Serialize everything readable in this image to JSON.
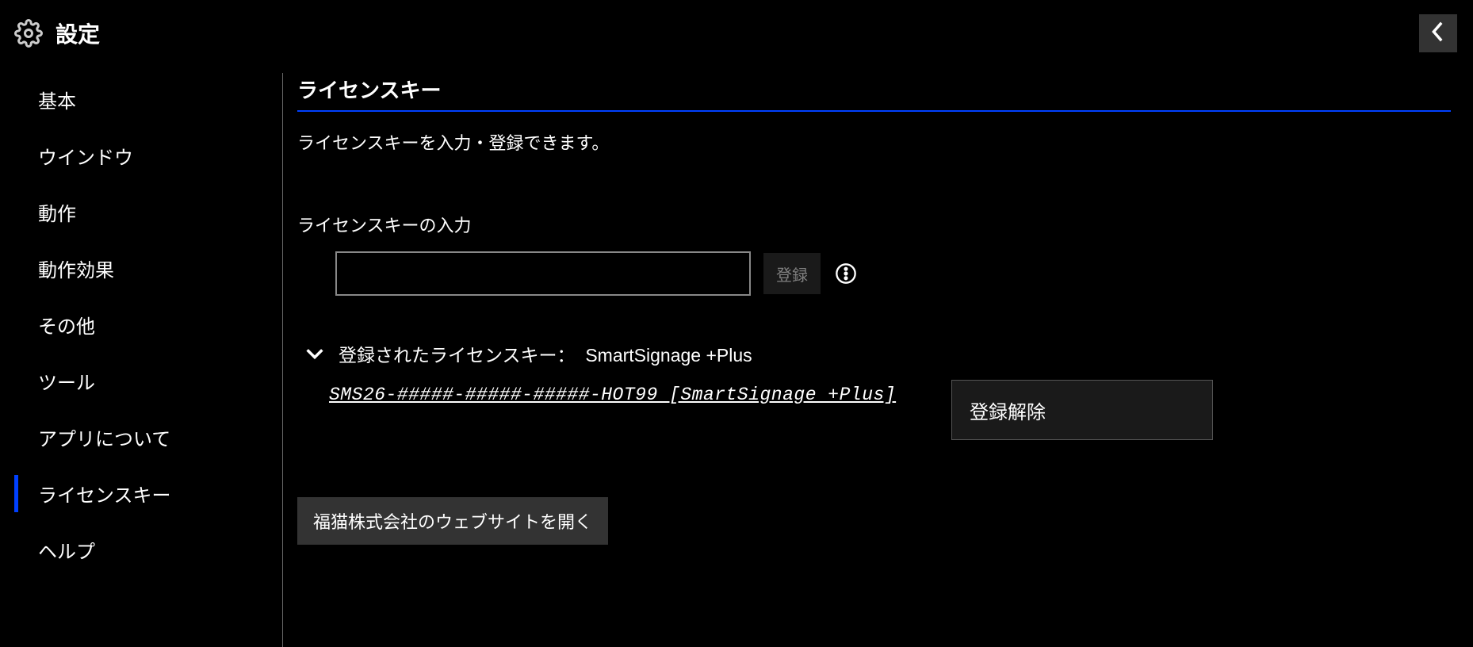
{
  "header": {
    "title": "設定"
  },
  "sidebar": {
    "items": [
      {
        "label": "基本"
      },
      {
        "label": "ウインドウ"
      },
      {
        "label": "動作"
      },
      {
        "label": "動作効果"
      },
      {
        "label": "その他"
      },
      {
        "label": "ツール"
      },
      {
        "label": "アプリについて"
      },
      {
        "label": "ライセンスキー"
      },
      {
        "label": "ヘルプ"
      }
    ]
  },
  "main": {
    "section_title": "ライセンスキー",
    "description": "ライセンスキーを入力・登録できます。",
    "input_label": "ライセンスキーの入力",
    "register_button": "登録",
    "registered_label": "登録されたライセンスキー：",
    "registered_product": "SmartSignage +Plus",
    "license_key_value": "SMS26-#####-#####-#####-HOT99  [SmartSignage +Plus]",
    "unregister_button": "登録解除",
    "website_button": "福猫株式会社のウェブサイトを開く"
  }
}
